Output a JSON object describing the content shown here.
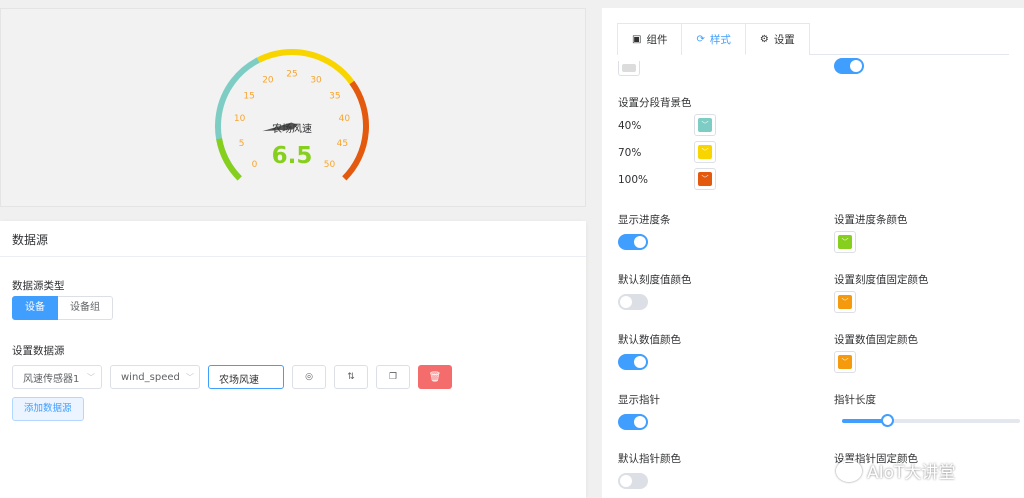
{
  "gauge": {
    "title": "农场风速",
    "value": "6.5",
    "ticks": [
      "0",
      "5",
      "10",
      "15",
      "20",
      "25",
      "30",
      "35",
      "40",
      "45",
      "50"
    ],
    "min": 0,
    "max": 50,
    "value_num": 6.5,
    "segments": [
      {
        "upto": 0.4,
        "color": "#7ecdc4"
      },
      {
        "upto": 0.7,
        "color": "#f9d500"
      },
      {
        "upto": 1.0,
        "color": "#e35a0e"
      }
    ],
    "progress_color": "#86cf1c",
    "tick_color": "#f7a631",
    "value_color": "#86cf1c"
  },
  "datasource": {
    "header": "数据源",
    "type_label": "数据源类型",
    "type_options": [
      "设备",
      "设备组"
    ],
    "config_label": "设置数据源",
    "device_select": "风速传感器1",
    "field_select": "wind_speed",
    "name_input": "农场风速",
    "add_button": "添加数据源"
  },
  "settings": {
    "tabs": [
      {
        "label": "组件",
        "icon": "▣"
      },
      {
        "label": "样式",
        "icon": "⟳"
      },
      {
        "label": "设置",
        "icon": "⚙"
      }
    ],
    "active_tab": 1,
    "segment_bg_label": "设置分段背景色",
    "segments": [
      {
        "pct": "40%",
        "color": "#7ecdc4"
      },
      {
        "pct": "70%",
        "color": "#f9d500"
      },
      {
        "pct": "100%",
        "color": "#e35a0e"
      }
    ],
    "show_progress": {
      "label": "显示进度条",
      "on": true
    },
    "progress_color": {
      "label": "设置进度条颜色",
      "color": "#86cf1c"
    },
    "default_tick_color": {
      "label": "默认刻度值颜色",
      "on": false
    },
    "fixed_tick_color": {
      "label": "设置刻度值固定颜色",
      "color": "#f59a0c"
    },
    "default_value_color": {
      "label": "默认数值颜色",
      "on": true
    },
    "fixed_value_color": {
      "label": "设置数值固定颜色",
      "color": "#f59a0c"
    },
    "show_pointer": {
      "label": "显示指针",
      "on": true
    },
    "pointer_length": {
      "label": "指针长度",
      "value": 0.25
    },
    "default_pointer_color": {
      "label": "默认指针颜色",
      "on": false
    },
    "fixed_pointer_color": {
      "label": "设置指针固定颜色"
    }
  },
  "watermark": "AIoT大讲堂"
}
